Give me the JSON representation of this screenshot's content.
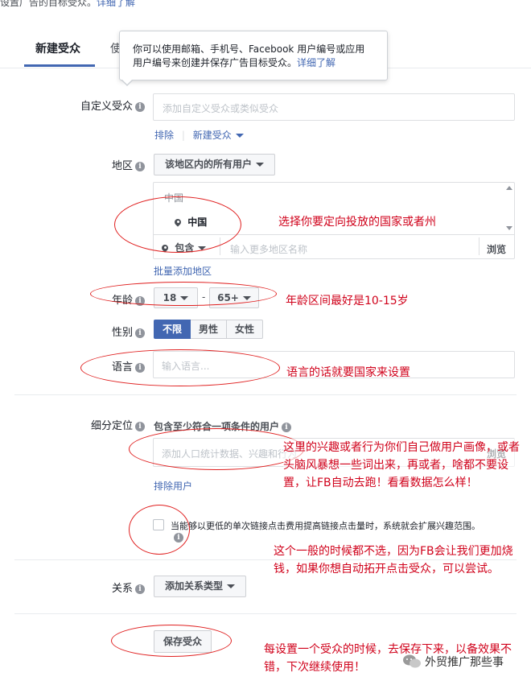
{
  "top_text": {
    "text": "设置广告的目标受众。",
    "link": "详细了解"
  },
  "tabs": {
    "new_audience": "新建受众",
    "other_partial": "使"
  },
  "tooltip": {
    "text": "你可以使用邮箱、手机号、Facebook 用户编号或应用用户编号来创建并保存广告目标受众。",
    "link": "详细了解"
  },
  "custom_audience": {
    "label": "自定义受众",
    "placeholder": "添加自定义受众或类似受众",
    "exclude": "排除",
    "create_new": "新建受众"
  },
  "location": {
    "label": "地区",
    "dropdown": "该地区内的所有用户",
    "country_header": "中国",
    "selected": "中国",
    "include": "包含",
    "placeholder": "输入更多地区名称",
    "browse": "浏览",
    "bulk_add": "批量添加地区"
  },
  "age": {
    "label": "年龄",
    "min": "18",
    "max": "65+",
    "separator": "-"
  },
  "gender": {
    "label": "性别",
    "options": [
      "不限",
      "男性",
      "女性"
    ],
    "selected": "不限"
  },
  "language": {
    "label": "语言",
    "placeholder": "输入语言..."
  },
  "detailed_targeting": {
    "label": "细分定位",
    "heading": "包含至少符合一项条件的用户",
    "placeholder": "添加人口统计数据、兴趣和行为",
    "browse_partial": "浏览",
    "exclude": "排除用户",
    "expand_text": "当能够以更低的单次链接点击费用提高链接点击量时，系统就会扩展兴趣范围。"
  },
  "connections": {
    "label": "关系",
    "dropdown": "添加关系类型"
  },
  "save": {
    "label": "保存受众"
  },
  "annotations": {
    "location_note": "选择你要定向投放的国家或者州",
    "age_note": "年龄区间最好是10-15岁",
    "language_note": "语言的话就要国家来设置",
    "interest_note": "这里的兴趣或者行为你们自己做用户画像，或者头脑风暴想一些词出来，再或者，啥都不要设置，让FB自动去跑！看看数据怎么样！",
    "expand_note": "这个一般的时候都不选，因为FB会让我们更加烧钱，如果你想自动拓开点击受众，可以尝试。",
    "save_note": "每设置一个受众的时候，去保存下来，以备效果不错，下次继续使用！"
  },
  "watermark": {
    "text": "外贸推广那些事"
  },
  "colors": {
    "accent": "#4267b2",
    "annotation_red": "#d0021b"
  }
}
